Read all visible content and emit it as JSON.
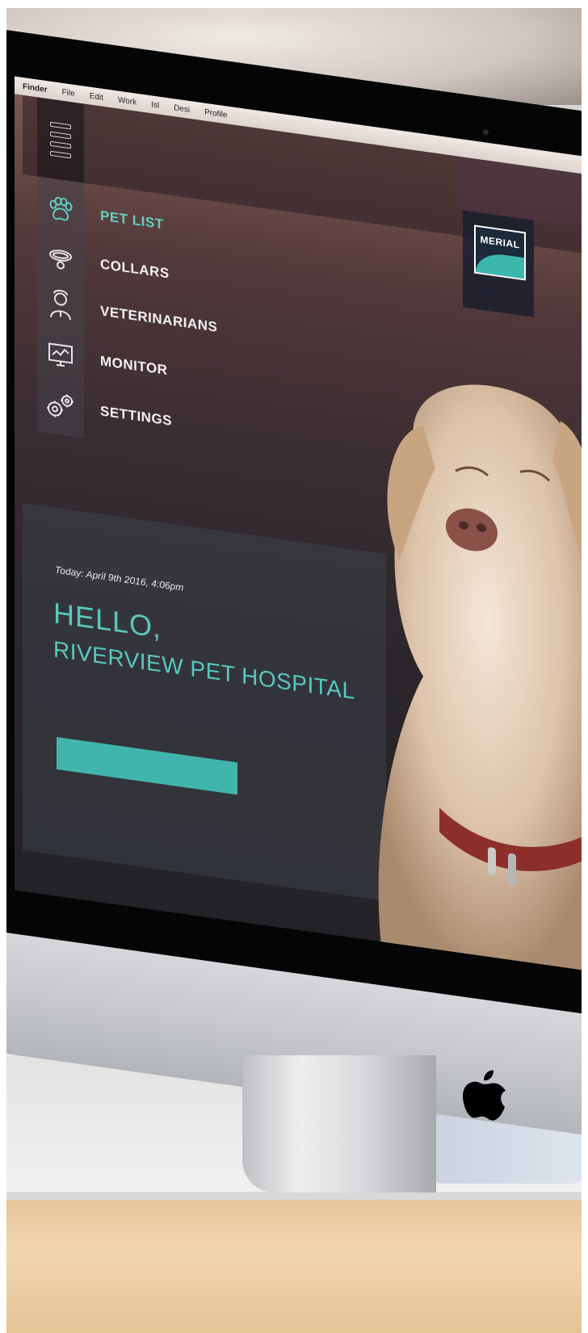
{
  "menubar": {
    "items": [
      "Finder",
      "File",
      "Edit",
      "Work",
      "Isl",
      "Desi",
      "Profile"
    ]
  },
  "logo": {
    "text": "MERIAL"
  },
  "nav": {
    "items": [
      {
        "label": "PET LIST",
        "icon": "paw-icon",
        "active": true
      },
      {
        "label": "COLLARS",
        "icon": "collar-icon",
        "active": false
      },
      {
        "label": "VETERINARIANS",
        "icon": "veterinarian-icon",
        "active": false
      },
      {
        "label": "MONITOR",
        "icon": "monitor-icon",
        "active": false
      },
      {
        "label": "SETTINGS",
        "icon": "gears-icon",
        "active": false
      }
    ]
  },
  "hero": {
    "date": "Today: April 9th 2016, 4:06pm",
    "greeting": "HELLO,",
    "clinic": "RIVERVIEW PET HOSPITAL"
  },
  "colors": {
    "accent": "#5fd0c4",
    "button": "#41b5ab"
  }
}
